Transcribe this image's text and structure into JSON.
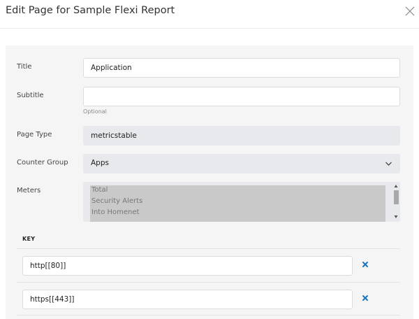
{
  "dialog": {
    "title": "Edit Page for Sample Flexi Report"
  },
  "form": {
    "title_label": "Title",
    "title_value": "Application",
    "subtitle_label": "Subtitle",
    "subtitle_value": "",
    "subtitle_hint": "Optional",
    "page_type_label": "Page Type",
    "page_type_value": "metricstable",
    "counter_group_label": "Counter Group",
    "counter_group_value": "Apps",
    "meters_label": "Meters",
    "meters_options": [
      "Total",
      "Security Alerts",
      "Into Homenet"
    ]
  },
  "keys": {
    "header": "KEY",
    "rows": [
      {
        "value": "http[[80]]"
      },
      {
        "value": "https[[443]]"
      }
    ]
  },
  "colors": {
    "accent": "#1e73be",
    "panel_bg": "#f5f5f5",
    "readonly_bg": "#e8e9ec"
  },
  "icons": {
    "close": "close-icon",
    "dropdown": "chevron-down-icon",
    "remove": "remove-icon"
  }
}
